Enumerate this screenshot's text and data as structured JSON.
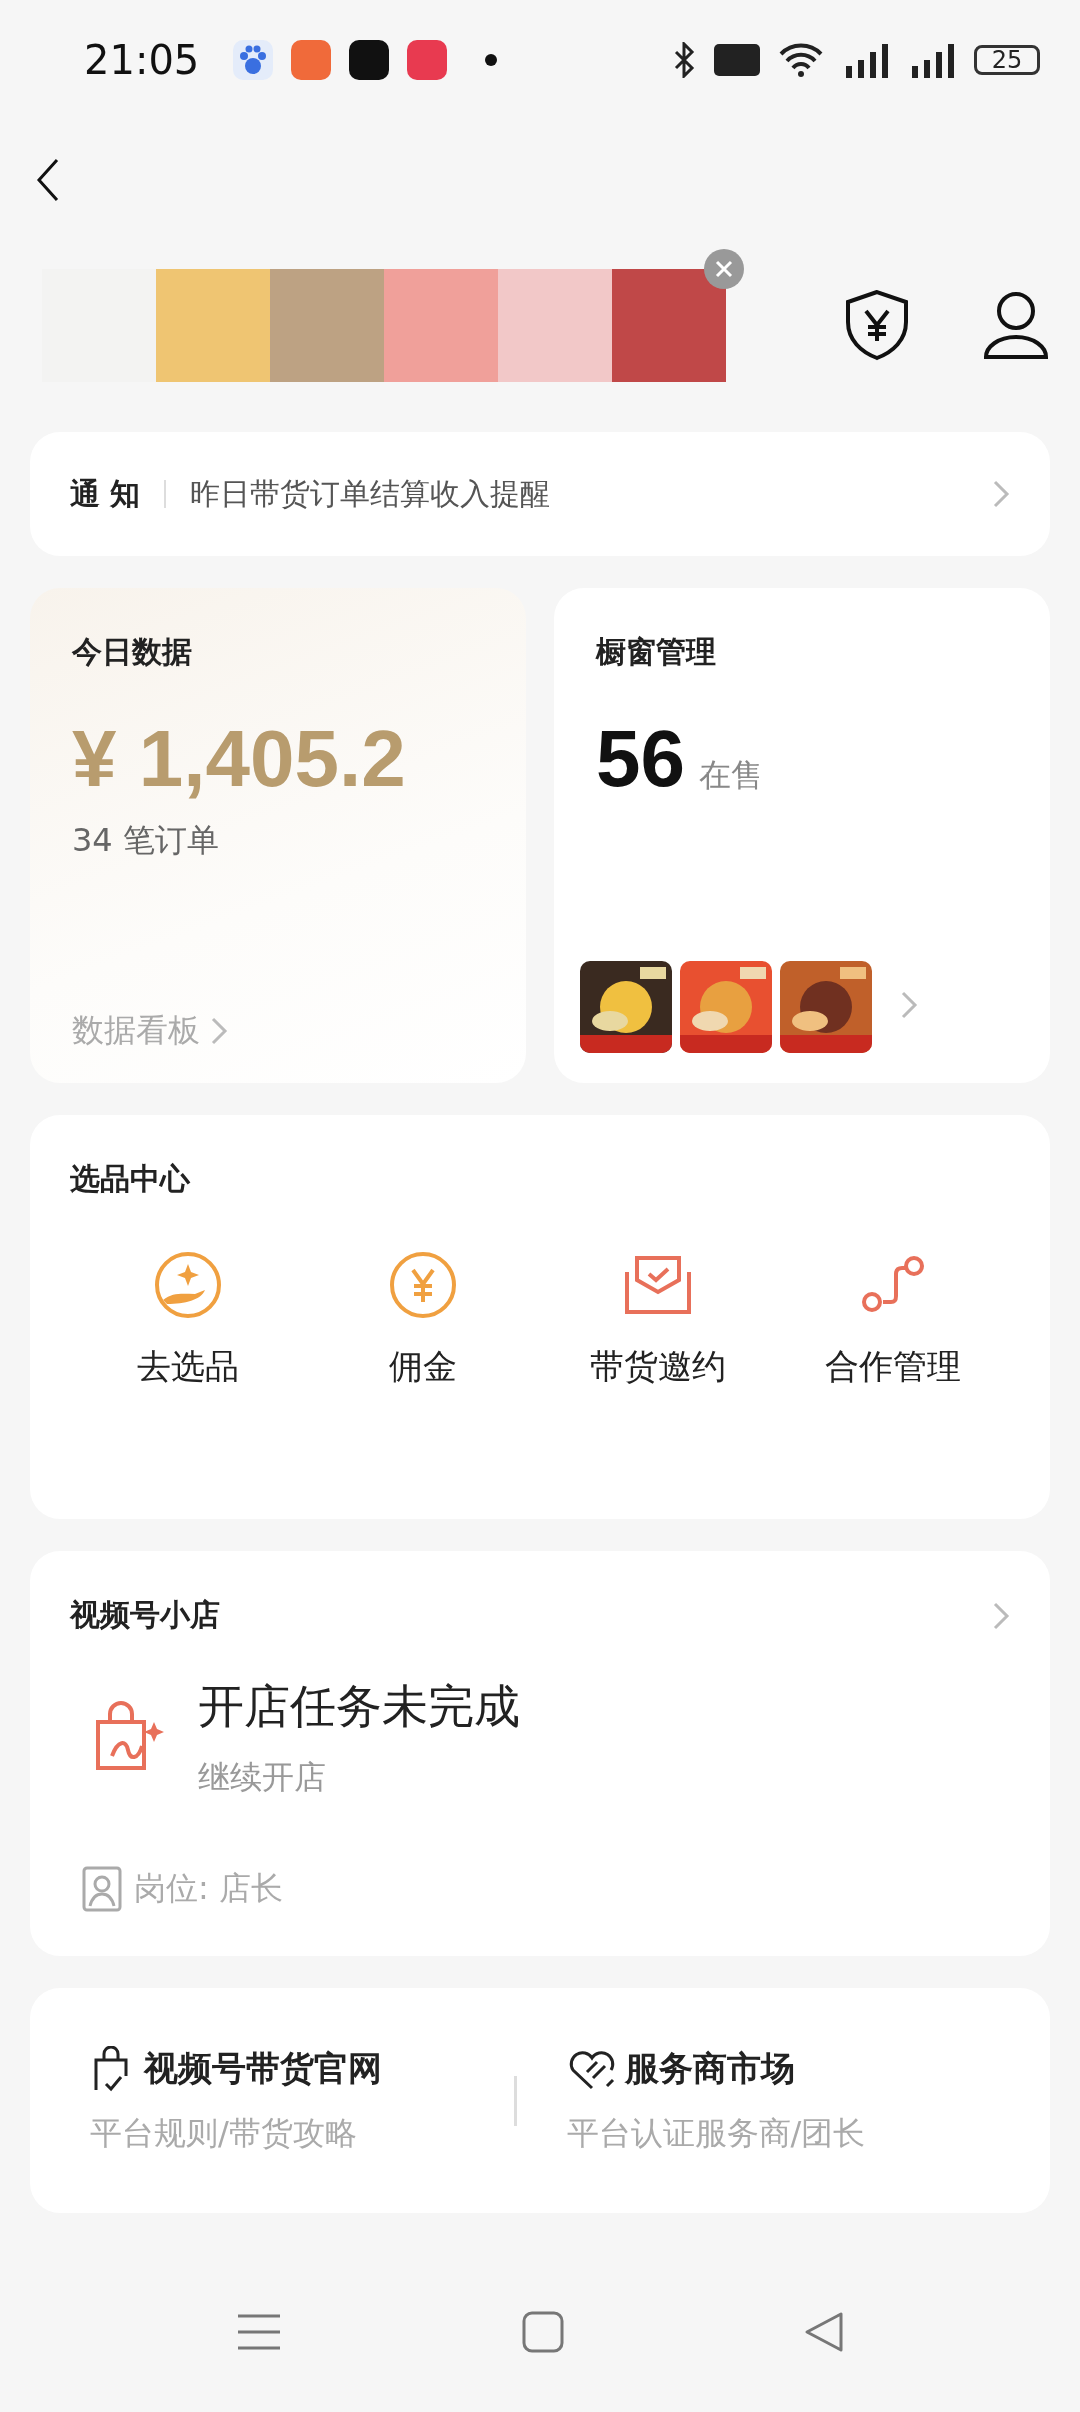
{
  "status_bar": {
    "time": "21:05",
    "battery": "25"
  },
  "header": {
    "palette": [
      {
        "color": "#f3f3f2"
      },
      {
        "color": "#efc572"
      },
      {
        "color": "#bda283"
      },
      {
        "color": "#f0a09a"
      },
      {
        "color": "#f2c8c8"
      },
      {
        "color": "#c04848"
      }
    ]
  },
  "notice": {
    "label": "通 知",
    "text": "昨日带货订单结算收入提醒"
  },
  "today": {
    "title": "今日数据",
    "amount": "¥ 1,405.2",
    "orders": "34 笔订单",
    "link": "数据看板"
  },
  "showcase": {
    "title": "橱窗管理",
    "count": "56",
    "count_label": "在售"
  },
  "selection": {
    "title": "选品中心",
    "items": [
      {
        "kind": "hand",
        "label": "去选品"
      },
      {
        "kind": "yen",
        "label": "佣金"
      },
      {
        "kind": "envelope",
        "label": "带货邀约"
      },
      {
        "kind": "link",
        "label": "合作管理"
      }
    ]
  },
  "shop": {
    "title": "视频号小店",
    "task": "开店任务未完成",
    "action": "继续开店",
    "role": "岗位: 店长"
  },
  "links": [
    {
      "kind": "bag",
      "title": "视频号带货官网",
      "subtitle": "平台规则/带货攻略"
    },
    {
      "kind": "heart",
      "title": "服务商市场",
      "subtitle": "平台认证服务商/团长"
    }
  ]
}
